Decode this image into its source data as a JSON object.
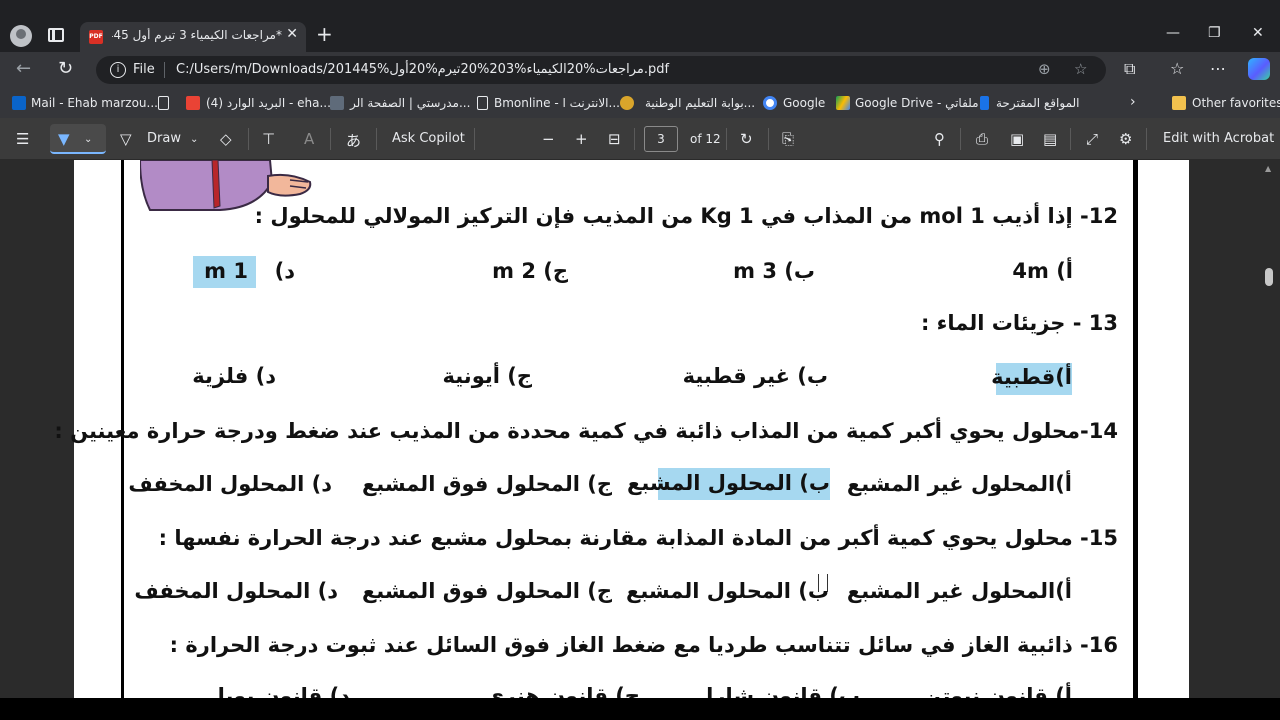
{
  "browser": {
    "tab": {
      "title": "*مراجعات الكيمياء 3 تيرم أول 1445.pdf",
      "favicon_label": "PDF"
    },
    "address": {
      "scheme_label": "File",
      "url": "C:/Users/m/Downloads/201445%مراجعات%20الكيمياء%203%20تيرم%20أول.pdf"
    },
    "bookmarks": [
      {
        "label": "Mail - Ehab marzou...",
        "icon": "outlook-icon"
      },
      {
        "label": "",
        "icon": "page-icon"
      },
      {
        "label": "(4) البريد الوارد - eha...",
        "icon": "gmail-icon"
      },
      {
        "label": "مدرستي | الصفحة الر...",
        "icon": "madrasati-icon"
      },
      {
        "label": "Bmonline - الانترنت ا...",
        "icon": "page-icon"
      },
      {
        "label": "بوابة التعليم الوطنية...",
        "icon": "ein-icon"
      },
      {
        "label": "Google",
        "icon": "google-icon"
      },
      {
        "label": "Google Drive - ملفاتي",
        "icon": "drive-icon"
      },
      {
        "label": "المواقع المقترحة",
        "icon": "bing-icon"
      },
      {
        "label": "Other favorites",
        "icon": "folder-icon"
      }
    ]
  },
  "pdf_toolbar": {
    "draw_label": "Draw",
    "ask_label": "Ask Copilot",
    "page_current": "3",
    "page_total": "of 12",
    "edit_label": "Edit with Acrobat"
  },
  "document": {
    "q12": {
      "prompt": "12- إذا أذيب  1  mol  من المذاب في  Kg  1  من المذيب فإن التركيز المولالي للمحلول :",
      "options": [
        "أ)      4m",
        "ب)   3  m",
        "ج)   2  m",
        "د)   1  m"
      ],
      "highlighted_value": "1  m",
      "d_prefix": "د)"
    },
    "q13": {
      "prompt": "13 - جزيئات الماء :",
      "options": [
        "أ)قطبية",
        "ب) غير قطبية",
        "ج) أيونية",
        "د) فلزية"
      ]
    },
    "q14": {
      "prompt": "14-محلول يحوي أكبر كمية من المذاب ذائبة في كمية محددة من المذيب عند ضغط ودرجة حرارة معينين :",
      "options": [
        "أ)المحلول غير المشبع",
        "ب) المحلول المشبع",
        "ج) المحلول فوق المشبع",
        "د) المحلول المخفف"
      ]
    },
    "q15": {
      "prompt": "15- محلول يحوي كمية أكبر من المادة المذابة مقارنة بمحلول مشبع عند درجة الحرارة نفسها :",
      "options": [
        "أ)المحلول غير المشبع",
        "ب) المحلول المشبع",
        "ج) المحلول فوق المشبع",
        "د) المحلول المخفف"
      ]
    },
    "q16": {
      "prompt": "16- ذائبية الغاز في سائل تتناسب طرديا مع ضغط الغاز فوق السائل عند ثبوت درجة الحرارة  :",
      "options_partial": [
        "أ) قانون نيوتن",
        "ب) قانون شارل",
        "ج) قانون هنري",
        "د) قانون بويل"
      ]
    }
  },
  "colors": {
    "highlight": "#a6d8f0",
    "page": "#ffffff",
    "viewer_bg": "#2b2b2b",
    "toolbar": "#3b3b3b"
  }
}
